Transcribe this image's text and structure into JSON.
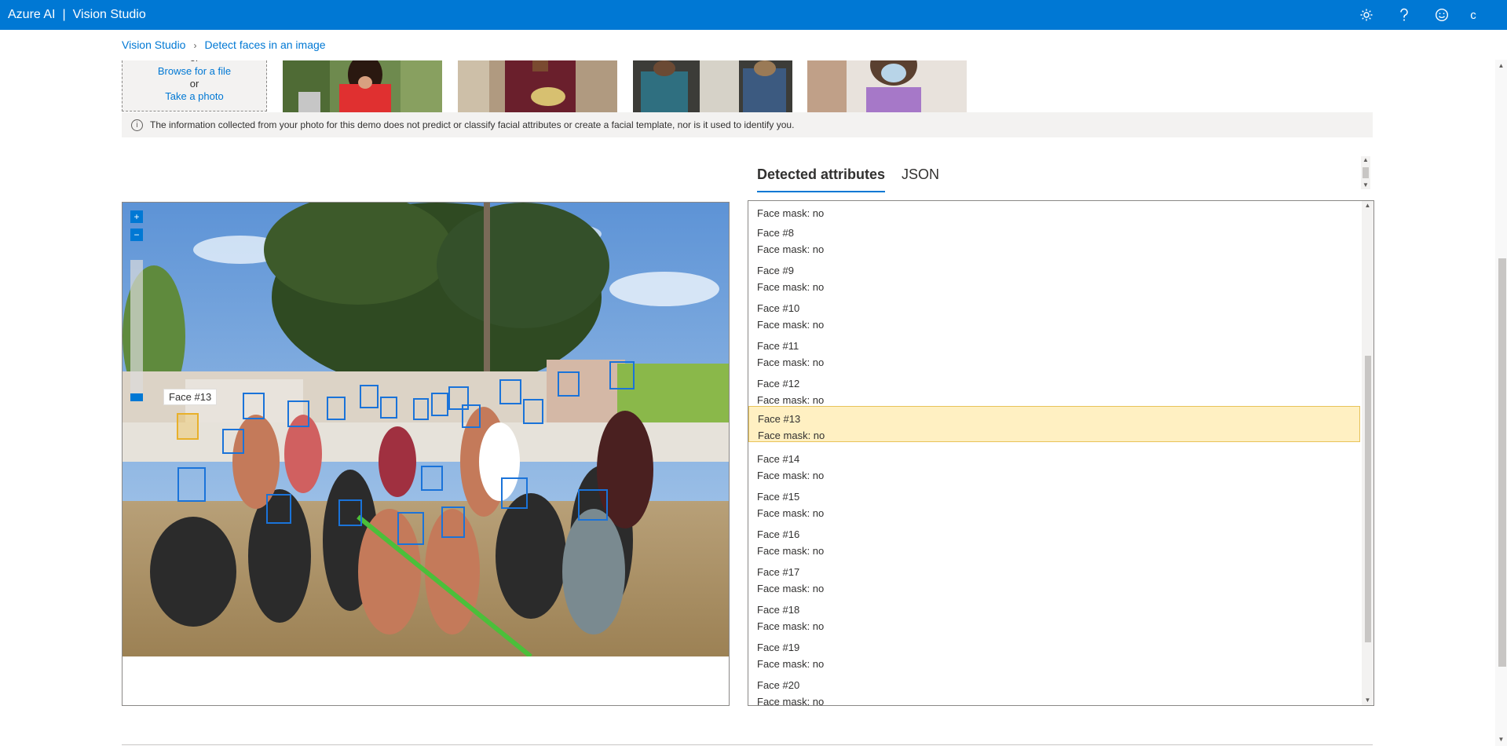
{
  "topbar": {
    "brand_primary": "Azure AI",
    "brand_separator": "|",
    "brand_secondary": "Vision Studio",
    "user_initial": "c",
    "icons": [
      "gear-icon",
      "help-icon",
      "smiley-feedback-icon"
    ]
  },
  "breadcrumb": {
    "home": "Vision Studio",
    "current": "Detect faces in an image",
    "separator": "›"
  },
  "upload": {
    "or_top": "or",
    "browse": "Browse for a file",
    "or": "or",
    "take_photo": "Take a photo"
  },
  "info": {
    "text": "The information collected from your photo for this demo does not predict or classify facial attributes or create a facial template, nor is it used to identify you."
  },
  "tabs": [
    "Detected attributes",
    "JSON"
  ],
  "image": {
    "tooltip": "Face #13",
    "zoom_in": "+",
    "zoom_out": "−"
  },
  "faces": [
    {
      "label": "",
      "value": "Face mask: no"
    },
    {
      "label": "Face #8",
      "value": "Face mask: no"
    },
    {
      "label": "Face #9",
      "value": "Face mask: no"
    },
    {
      "label": "Face #10",
      "value": "Face mask: no"
    },
    {
      "label": "Face #11",
      "value": "Face mask: no"
    },
    {
      "label": "Face #12",
      "value": "Face mask: no"
    },
    {
      "label": "Face #13",
      "value": "Face mask: no",
      "selected": true
    },
    {
      "label": "Face #14",
      "value": "Face mask: no"
    },
    {
      "label": "Face #15",
      "value": "Face mask: no"
    },
    {
      "label": "Face #16",
      "value": "Face mask: no"
    },
    {
      "label": "Face #17",
      "value": "Face mask: no"
    },
    {
      "label": "Face #18",
      "value": "Face mask: no"
    },
    {
      "label": "Face #19",
      "value": "Face mask: no"
    },
    {
      "label": "Face #20",
      "value": "Face mask: no"
    }
  ],
  "colors": {
    "accent": "#0078d4",
    "selected_bg": "#fff0c2",
    "face_box": "#1a73d9",
    "face_selected": "#e8b02a"
  }
}
